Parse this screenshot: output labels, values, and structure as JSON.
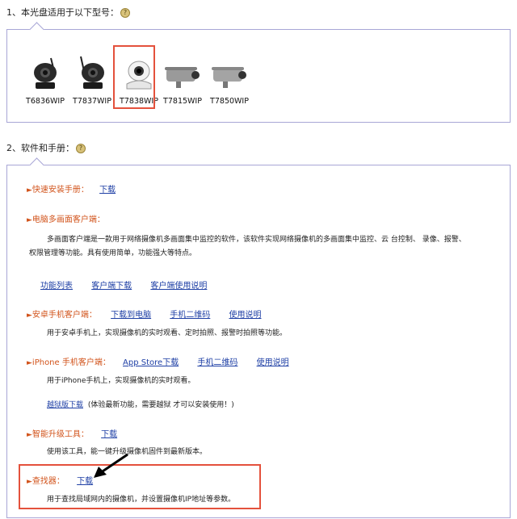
{
  "section1": {
    "heading": "1、本光盘适用于以下型号："
  },
  "models": [
    {
      "name": "T6836WIP",
      "icon": "ptz-camera-black"
    },
    {
      "name": "T7837WIP",
      "icon": "ptz-camera-black-antenna"
    },
    {
      "name": "T7838WIP",
      "icon": "ptz-camera-white"
    },
    {
      "name": "T7815WIP",
      "icon": "bullet-camera"
    },
    {
      "name": "T7850WIP",
      "icon": "bullet-camera"
    }
  ],
  "selected_model": "T7838WIP",
  "section2": {
    "heading": "2、软件和手册："
  },
  "quick_install": {
    "title": "快速安装手册：",
    "link": "下载"
  },
  "pc_client": {
    "title": "电脑多画面客户端：",
    "desc1": "多画面客户端是一款用于网络摄像机多画面集中监控的软件，该软件实现网络摄像机的多画面集中监控、云 台控制、 录像、报警、",
    "desc2": "权限管理等功能。具有使用简单，功能强大等特点。",
    "links": [
      "功能列表",
      "客户端下载",
      "客户端使用说明"
    ]
  },
  "android": {
    "title": "安卓手机客户端：",
    "links": [
      "下载到电脑",
      "手机二维码",
      "使用说明"
    ],
    "desc": "用于安卓手机上，实现摄像机的实时观看、定时拍照、报警时拍照等功能。"
  },
  "iphone": {
    "title": "iPhone 手机客户端：",
    "links": [
      "App Store下载",
      "手机二维码",
      "使用说明"
    ],
    "desc": "用于iPhone手机上，实现摄像机的实时观看。",
    "jailbreak_link": "越狱版下载",
    "jailbreak_note": "(体验最新功能，需要越狱 才可以安装使用！)"
  },
  "upgrade": {
    "title": "智能升级工具：",
    "link": "下载",
    "desc": "使用该工具，能一键升级摄像机固件到最新版本。"
  },
  "finder": {
    "title": "查找器：",
    "link": "下载",
    "desc": "用于查找局域网内的摄像机，并设置摄像机IP地址等参数。"
  },
  "colors": {
    "accent": "#d2541c",
    "link": "#1e3fa5",
    "highlight": "#e4513c",
    "panel_border": "#a8a6d6"
  }
}
